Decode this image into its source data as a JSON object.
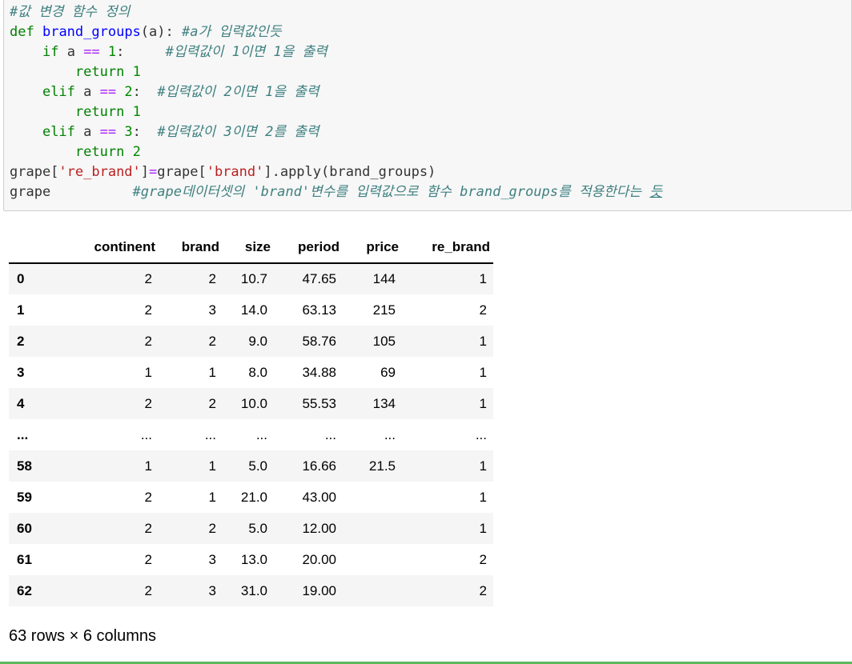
{
  "code_lines": [
    "#값 변경 함수 정의",
    "def brand_groups(a): #a가 입력값인듯",
    "    if a == 1:     #입력값이 1이면 1을 출력",
    "        return 1",
    "    elif a == 2:  #입력값이 2이면 1을 출력",
    "        return 1",
    "    elif a == 3:  #입력값이 3이면 2를 출력",
    "        return 2",
    "grape['re_brand']=grape['brand'].apply(brand_groups)",
    "grape          #grape데이터셋의 'brand'변수를 입력값으로 함수 brand_groups를 적용한다는 듯"
  ],
  "code_tokens": {
    "l1_comment": "#값 변경 함수 정의",
    "l2_def": "def",
    "l2_name": "brand_groups",
    "l2_args": "(a):",
    "l2_comment": "#a가 입력값인듯",
    "l3_if": "if",
    "l3_var": "a",
    "l3_op": "==",
    "l3_num": "1",
    "l3_colon": ":",
    "l3_comment": "#입력값이 1이면 1을 출력",
    "l4_return": "return",
    "l4_num": "1",
    "l5_elif": "elif",
    "l5_var": "a",
    "l5_op": "==",
    "l5_num": "2",
    "l5_colon": ":",
    "l5_comment": "#입력값이 2이면 1을 출력",
    "l6_return": "return",
    "l6_num": "1",
    "l7_elif": "elif",
    "l7_var": "a",
    "l7_op": "==",
    "l7_num": "3",
    "l7_colon": ":",
    "l7_comment": "#입력값이 3이면 2를 출력",
    "l8_return": "return",
    "l8_num": "2",
    "l9_a": "grape[",
    "l9_str1": "'re_brand'",
    "l9_b": "]",
    "l9_op": "=",
    "l9_c": "grape[",
    "l9_str2": "'brand'",
    "l9_d": "].apply(brand_groups)",
    "l10_var": "grape",
    "l10_comment": "#grape데이터셋의 'brand'변수를 입력값으로 함수 brand_groups를 적용한다는 ",
    "l10_link": "듯"
  },
  "table": {
    "columns": [
      "",
      "continent",
      "brand",
      "size",
      "period",
      "price",
      "re_brand"
    ],
    "rows": [
      [
        "0",
        "2",
        "2",
        "10.7",
        "47.65",
        "144",
        "1"
      ],
      [
        "1",
        "2",
        "3",
        "14.0",
        "63.13",
        "215",
        "2"
      ],
      [
        "2",
        "2",
        "2",
        "9.0",
        "58.76",
        "105",
        "1"
      ],
      [
        "3",
        "1",
        "1",
        "8.0",
        "34.88",
        "69",
        "1"
      ],
      [
        "4",
        "2",
        "2",
        "10.0",
        "55.53",
        "134",
        "1"
      ],
      [
        "...",
        "...",
        "...",
        "...",
        "...",
        "...",
        "..."
      ],
      [
        "58",
        "1",
        "1",
        "5.0",
        "16.66",
        "21.5",
        "1"
      ],
      [
        "59",
        "2",
        "1",
        "21.0",
        "43.00",
        "",
        "1"
      ],
      [
        "60",
        "2",
        "2",
        "5.0",
        "12.00",
        "",
        "1"
      ],
      [
        "61",
        "2",
        "3",
        "13.0",
        "20.00",
        "",
        "2"
      ],
      [
        "62",
        "2",
        "3",
        "31.0",
        "19.00",
        "",
        "2"
      ]
    ],
    "caption": "63 rows × 6 columns"
  },
  "colors": {
    "comment": "#408080",
    "keyword": "#008000",
    "def_name": "#0000ff",
    "operator": "#aa22ff",
    "string": "#ba2121",
    "cell_background": "#f7f7f7",
    "striped_row": "#f5f5f5"
  }
}
